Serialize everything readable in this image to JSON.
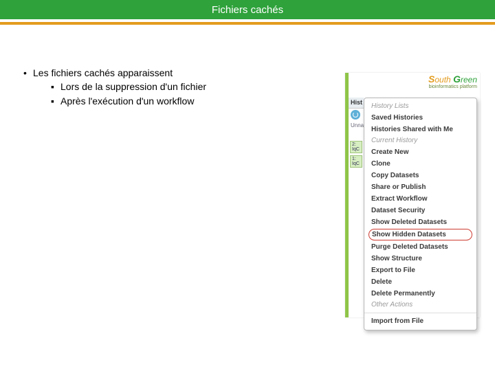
{
  "title": "Fichiers cachés",
  "body": {
    "intro": "Les fichiers cachés apparaissent",
    "sub1": "Lors de la suppression d'un fichier",
    "sub2": "Après l'exécution d'un workflow"
  },
  "logo": {
    "s": "S",
    "outh": "outh ",
    "g": "G",
    "reen": "reen",
    "sub": "bioinformatics platform"
  },
  "side": {
    "hist": "Hist",
    "unnamed": "Unna",
    "d2": "2:",
    "d2b": "IqC",
    "d1": "1:",
    "d1b": "IqC"
  },
  "menu": {
    "hdr1": "History Lists",
    "i1": "Saved Histories",
    "i2": "Histories Shared with Me",
    "hdr2": "Current History",
    "i3": "Create New",
    "i4": "Clone",
    "i5": "Copy Datasets",
    "i6": "Share or Publish",
    "i7": "Extract Workflow",
    "i8": "Dataset Security",
    "i9": "Show Deleted Datasets",
    "i10": "Show Hidden Datasets",
    "i11": "Purge Deleted Datasets",
    "i12": "Show Structure",
    "i13": "Export to File",
    "i14": "Delete",
    "i15": "Delete Permanently",
    "hdr3": "Other Actions",
    "i16": "Import from File"
  }
}
